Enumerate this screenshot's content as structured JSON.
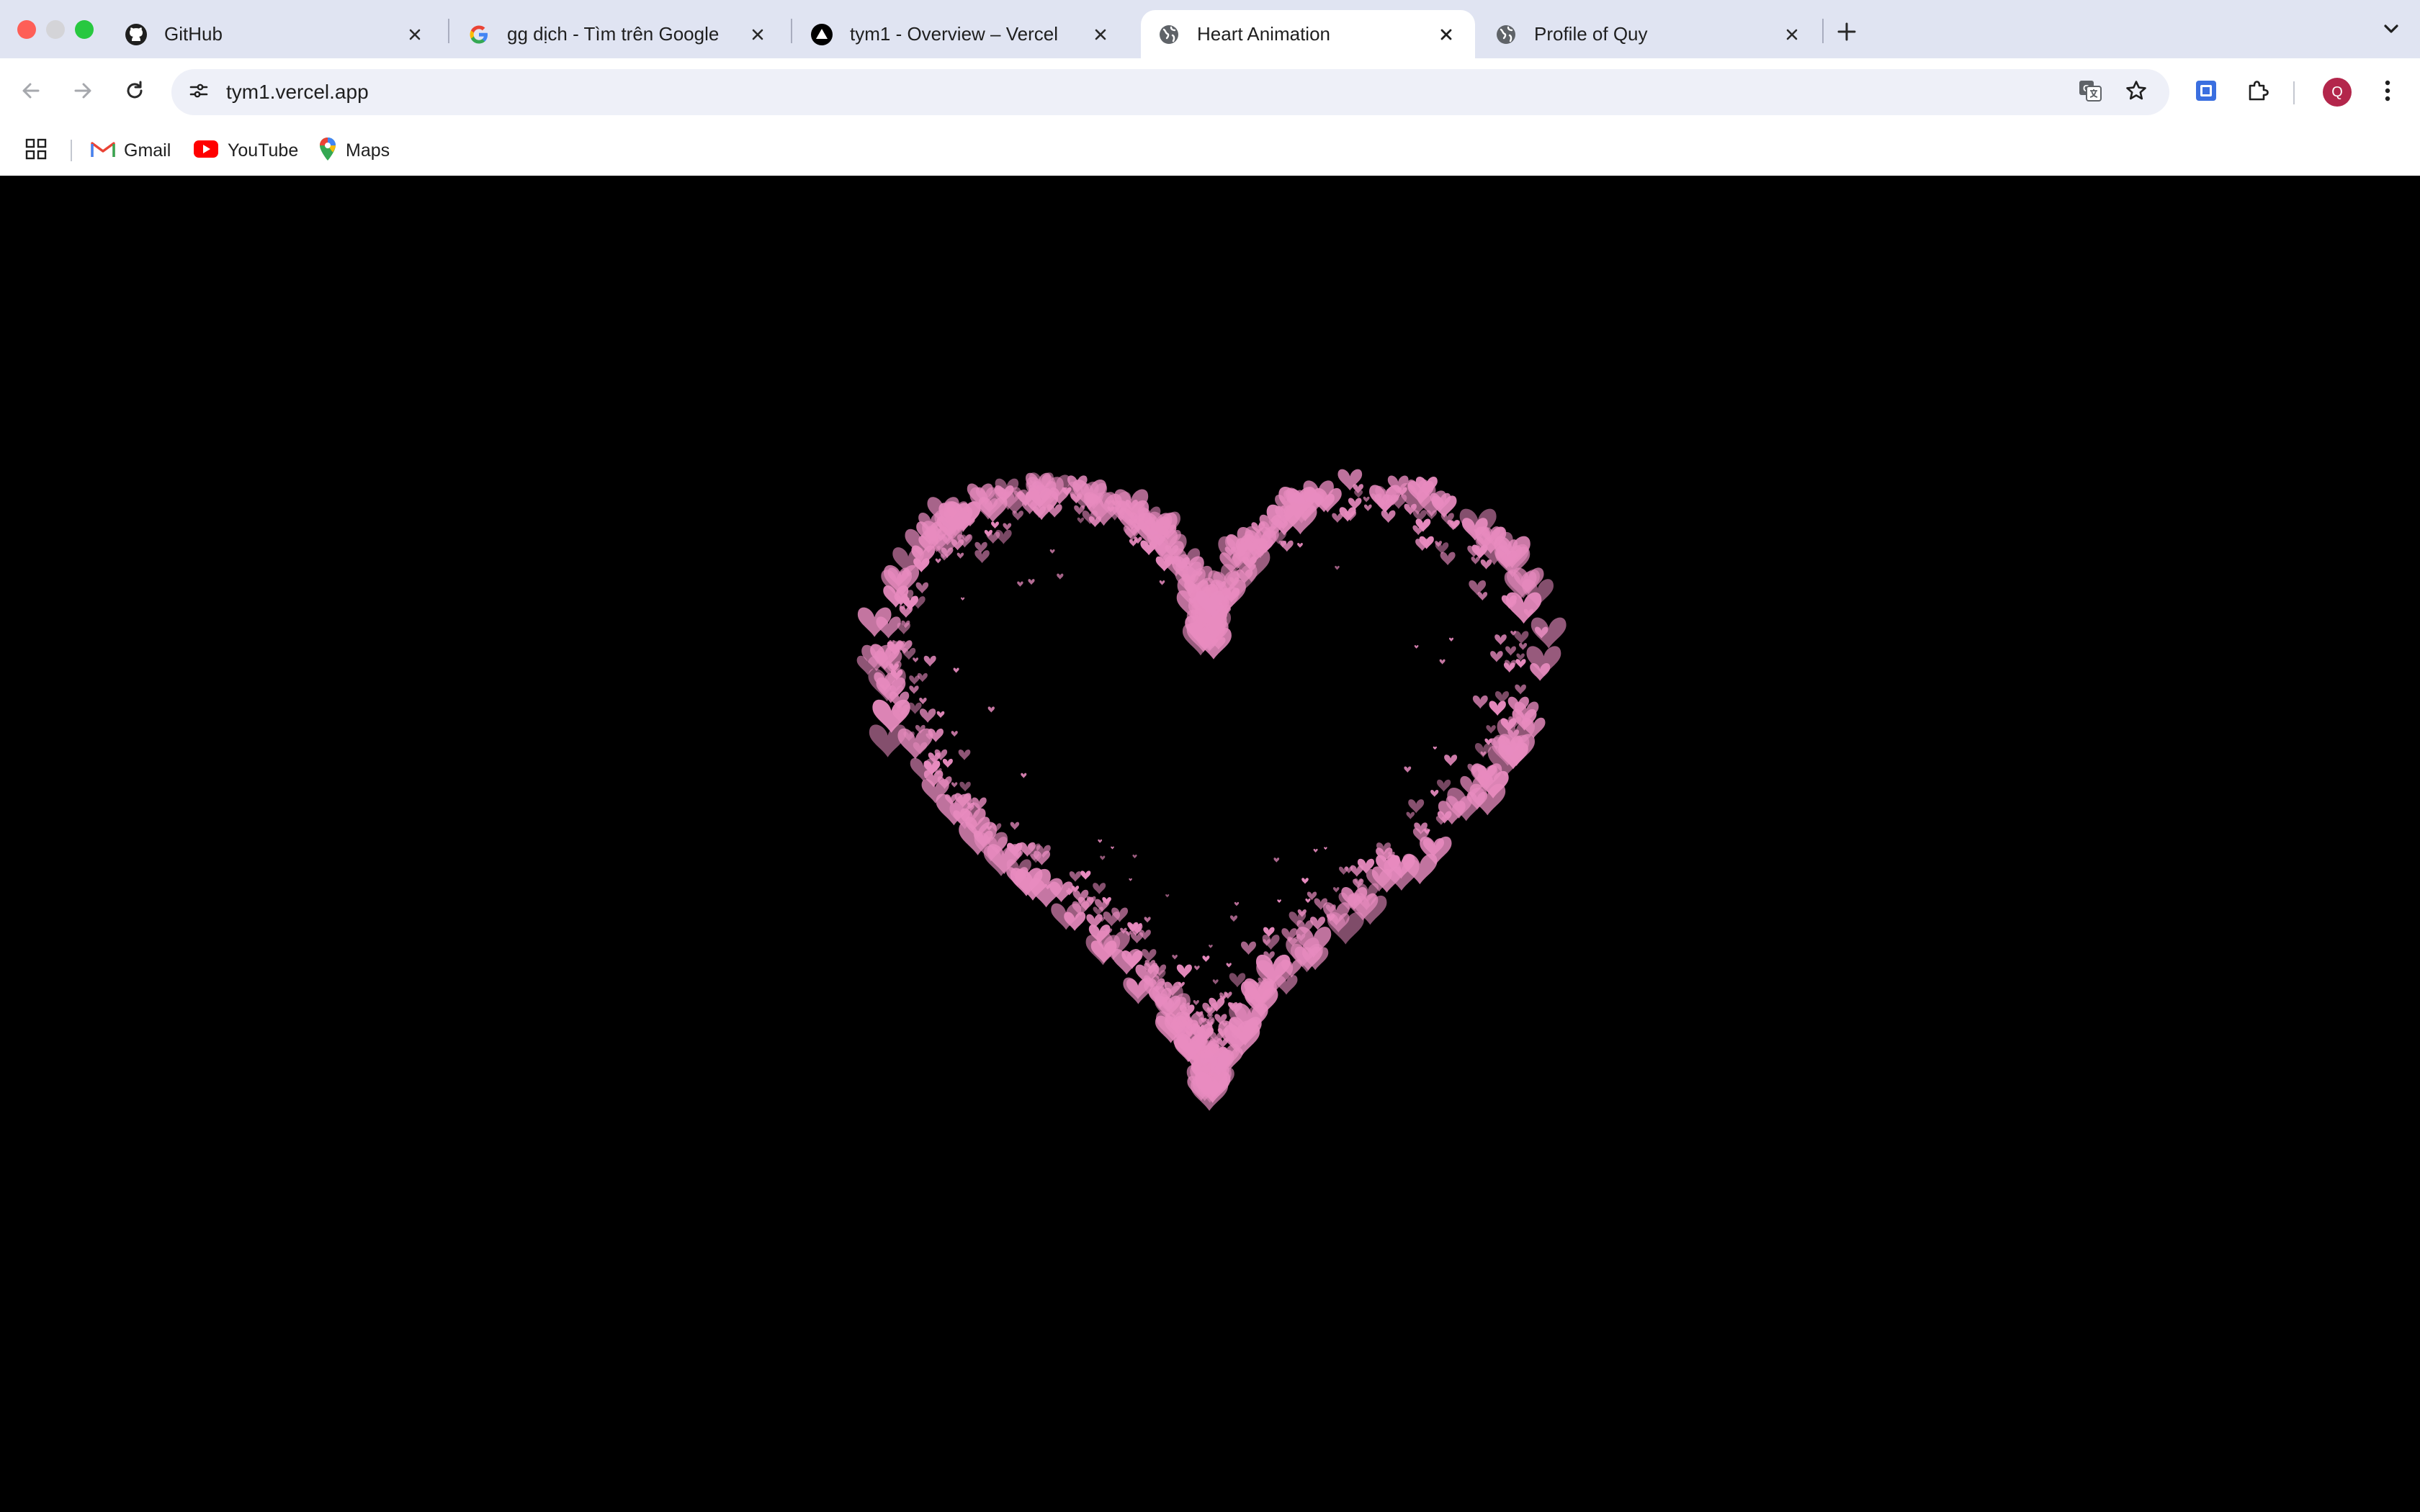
{
  "browser": {
    "tabs": [
      {
        "title": "GitHub",
        "icon": "github-icon",
        "active": false
      },
      {
        "title": "gg dịch - Tìm trên Google",
        "icon": "google-icon",
        "active": false
      },
      {
        "title": "tym1 - Overview – Vercel",
        "icon": "vercel-icon",
        "active": false
      },
      {
        "title": "Heart Animation",
        "icon": "globe-icon",
        "active": true
      },
      {
        "title": "Profile of Quy",
        "icon": "globe-icon",
        "active": false
      }
    ],
    "address": "tym1.vercel.app",
    "profile_initial": "Q",
    "bookmarks": [
      {
        "label": "Gmail",
        "icon": "gmail-icon"
      },
      {
        "label": "YouTube",
        "icon": "youtube-icon"
      },
      {
        "label": "Maps",
        "icon": "maps-icon"
      }
    ]
  },
  "colors": {
    "tabstrip": "#e0e4f2",
    "page_background": "#000000",
    "heart": "#e88bbf",
    "profile": "#b3264b"
  }
}
